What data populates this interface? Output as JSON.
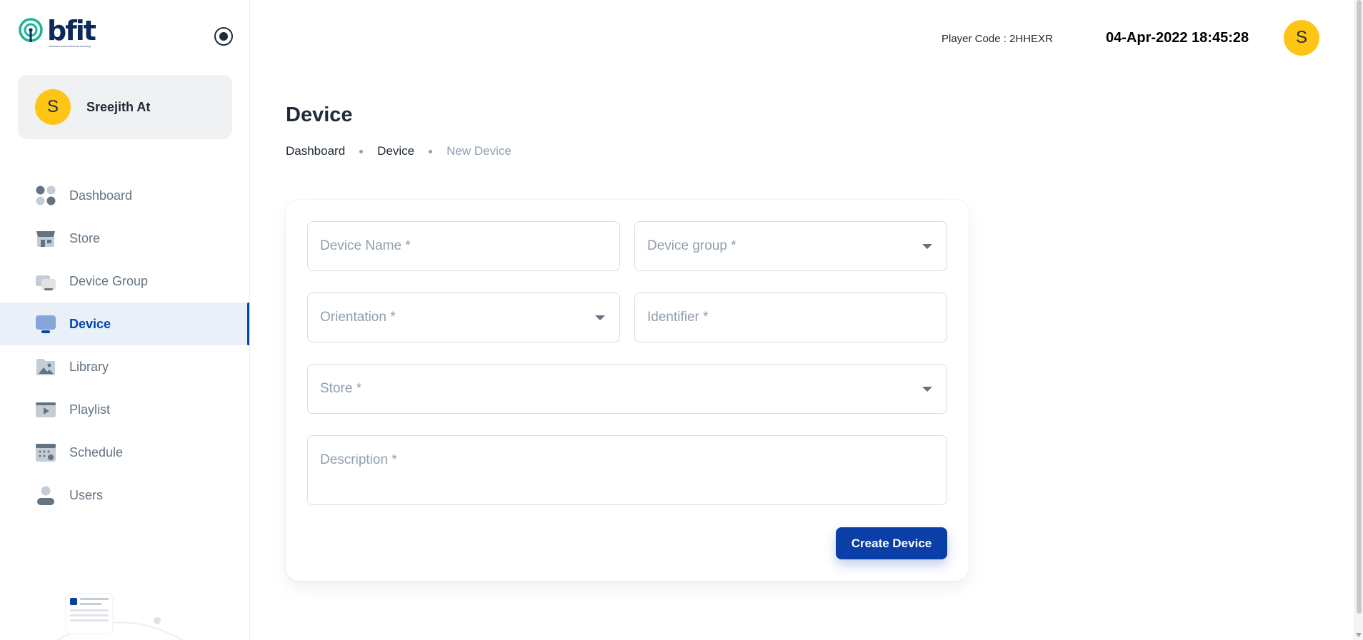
{
  "app": {
    "logo_text": "bfit",
    "logo_tagline": "Business & Fiscal Infrastructure Technology"
  },
  "account": {
    "initial": "S",
    "name": "Sreejith At"
  },
  "nav": {
    "items": [
      {
        "label": "Dashboard",
        "icon": "dashboard-icon"
      },
      {
        "label": "Store",
        "icon": "store-icon"
      },
      {
        "label": "Device Group",
        "icon": "device-group-icon"
      },
      {
        "label": "Device",
        "icon": "device-icon",
        "active": true
      },
      {
        "label": "Library",
        "icon": "library-icon"
      },
      {
        "label": "Playlist",
        "icon": "playlist-icon"
      },
      {
        "label": "Schedule",
        "icon": "schedule-icon"
      },
      {
        "label": "Users",
        "icon": "users-icon"
      }
    ]
  },
  "header": {
    "player_code": "Player Code : 2HHEXR",
    "datetime": "04-Apr-2022 18:45:28",
    "avatar_initial": "S"
  },
  "page": {
    "title": "Device",
    "breadcrumb": [
      "Dashboard",
      "Device",
      "New Device"
    ]
  },
  "form": {
    "device_name": {
      "placeholder": "Device Name *",
      "value": ""
    },
    "device_group": {
      "placeholder": "Device group *",
      "value": ""
    },
    "orientation": {
      "placeholder": "Orientation *",
      "value": ""
    },
    "identifier": {
      "placeholder": "Identifier *",
      "value": ""
    },
    "store": {
      "placeholder": "Store *",
      "value": ""
    },
    "description": {
      "placeholder": "Description *",
      "value": ""
    },
    "submit_label": "Create Device"
  },
  "colors": {
    "primary": "#0a3fa8",
    "avatar": "#fec514",
    "nav_active_bg": "#e9f0f8",
    "logo_teal": "#1ab394"
  }
}
